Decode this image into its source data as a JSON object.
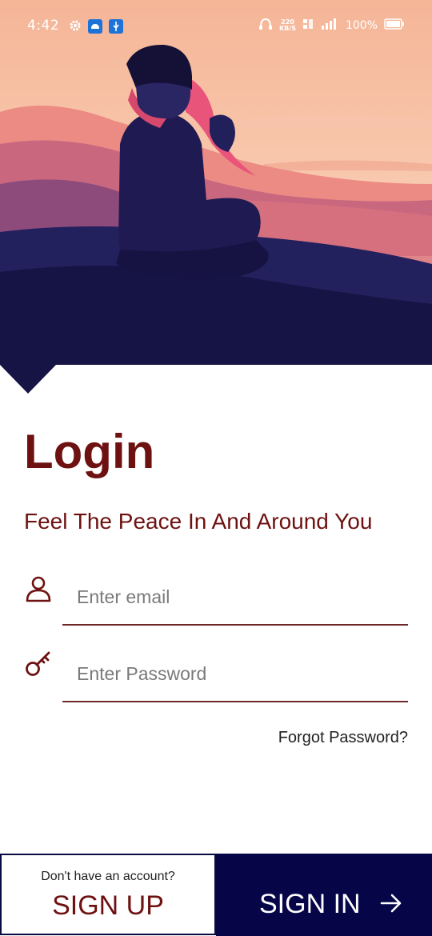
{
  "status_bar": {
    "time": "4:42",
    "net_speed_value": "220",
    "net_speed_unit": "KB/S",
    "battery": "100%"
  },
  "login": {
    "title": "Login",
    "tagline": "Feel The Peace In And Around You",
    "email_placeholder": "Enter email",
    "password_placeholder": "Enter Password",
    "forgot_password": "Forgot Password?"
  },
  "footer": {
    "signup_hint": "Don't have an account?",
    "signup_label": "SIGN UP",
    "signin_label": "SIGN IN"
  },
  "colors": {
    "accent": "#6e1111",
    "navy": "#050548",
    "sky": "#f4b69a"
  }
}
